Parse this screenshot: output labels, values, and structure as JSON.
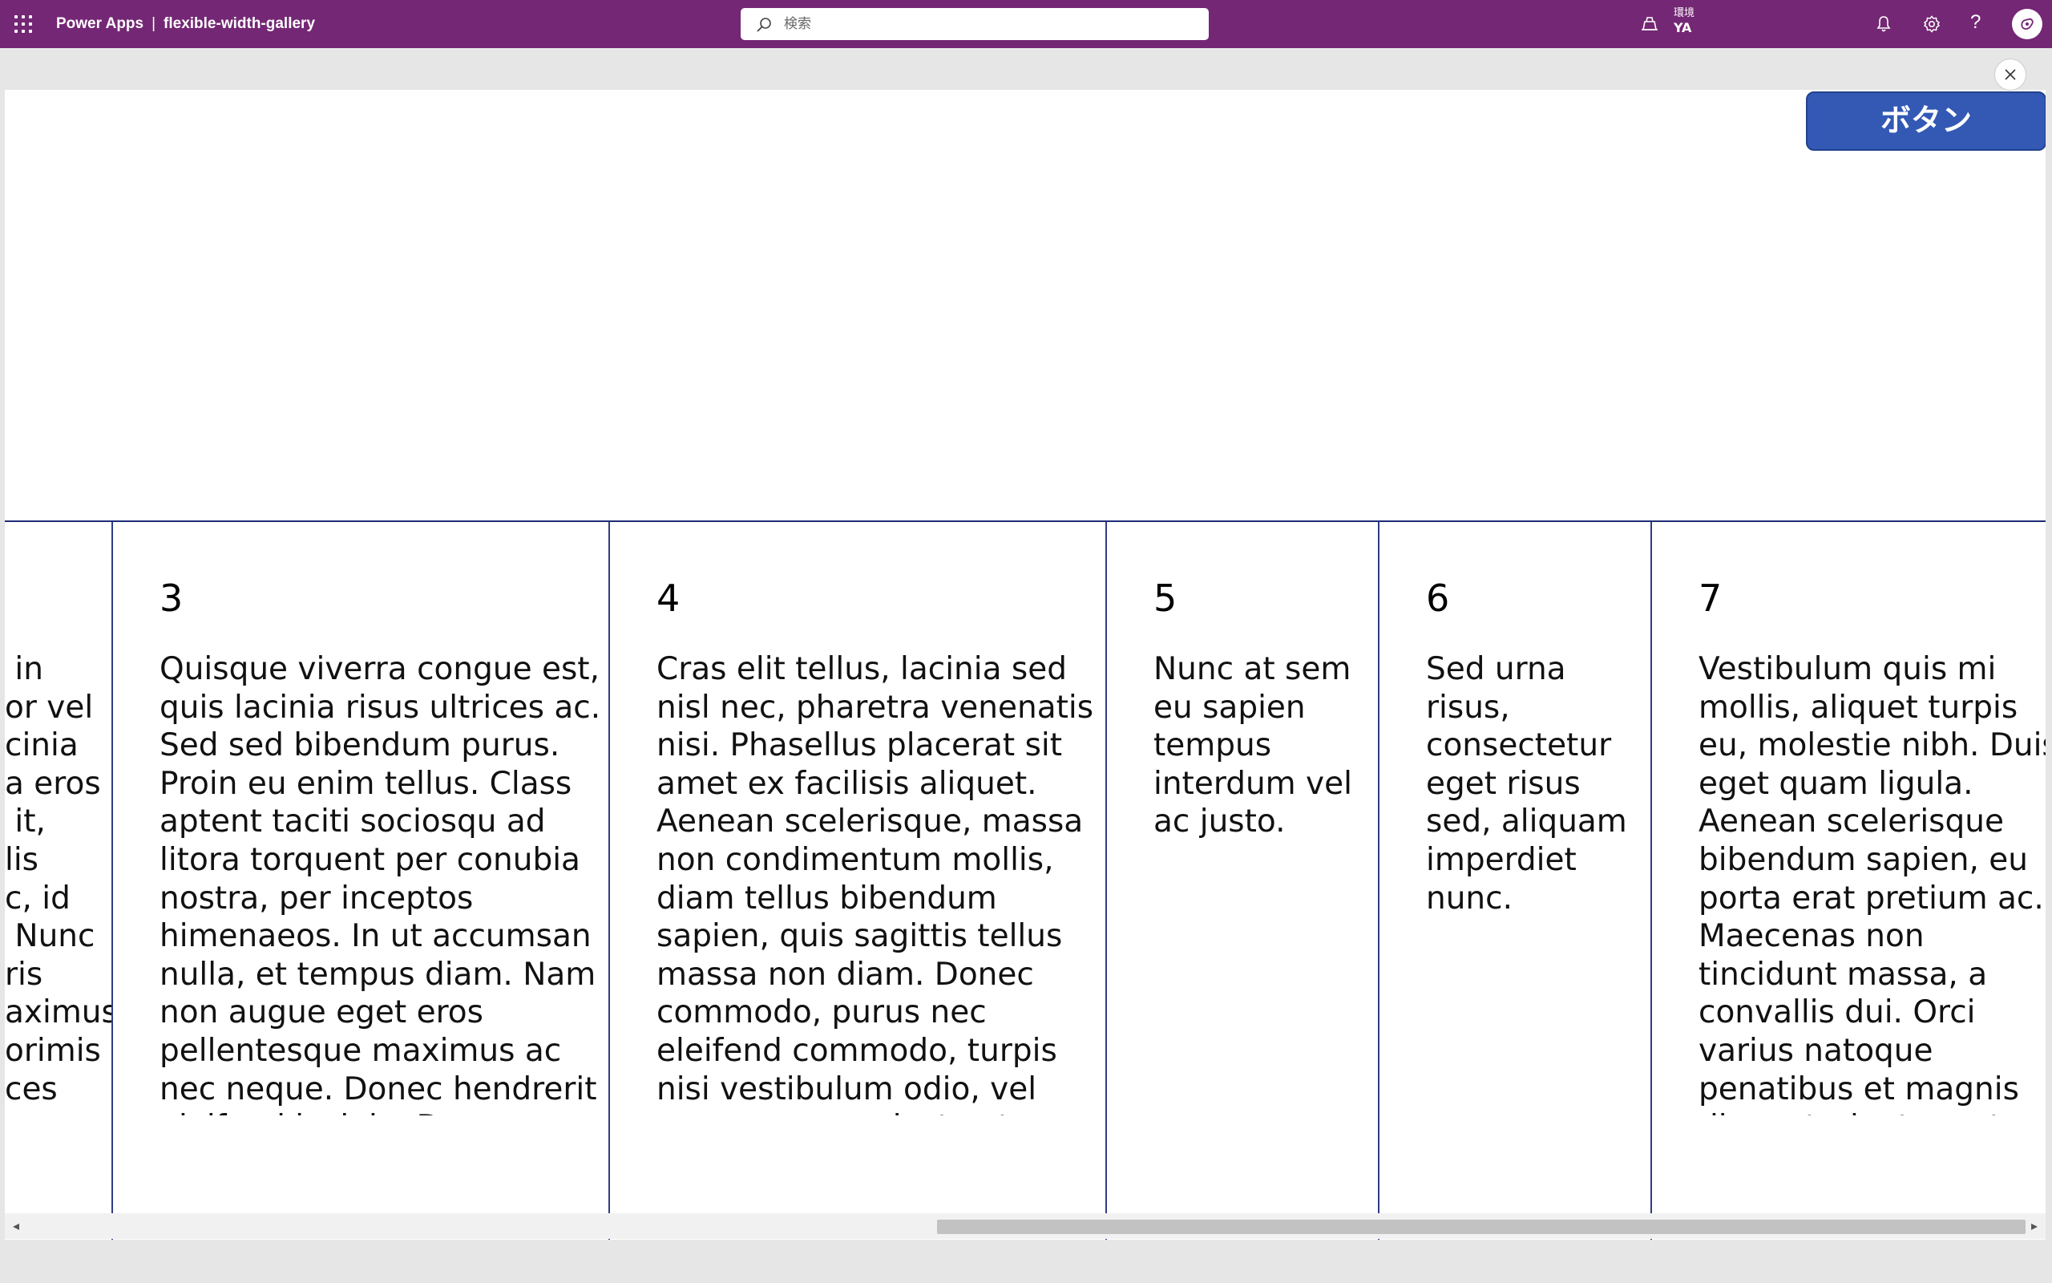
{
  "topbar": {
    "app_name": "Power Apps",
    "separator": "|",
    "app_title": "flexible-width-gallery",
    "search_placeholder": "検索",
    "environment_label": "環境",
    "environment_value": "YA",
    "help_label": "?"
  },
  "canvas": {
    "button_label": "ボタン"
  },
  "gallery": {
    "items": [
      {
        "number": "",
        "text": " in\nor vel\ncinia\na eros\n it,\nlis\nc, id\n Nunc\nris\naximus\norimis\nces"
      },
      {
        "number": "3",
        "text": "Quisque viverra congue est, quis lacinia risus ultrices ac. Sed sed bibendum purus. Proin eu enim tellus. Class aptent taciti sociosqu ad litora torquent per conubia nostra, per inceptos himenaeos. In ut accumsan nulla, et tempus diam. Nam non augue eget eros pellentesque maximus ac nec neque. Donec hendrerit eleifend lacinia. Donec aliquam aliquet nibh"
      },
      {
        "number": "4",
        "text": "Cras elit tellus, lacinia sed nisl nec, pharetra venenatis nisi. Phasellus placerat sit amet ex facilisis aliquet. Aenean scelerisque, massa non condimentum mollis, diam tellus bibendum sapien, quis sagittis tellus massa non diam. Donec commodo, purus nec eleifend commodo, turpis nisi vestibulum odio, vel congue massa justo et neque. Mauris blandit"
      },
      {
        "number": "5",
        "text": "Nunc at sem eu sapien tempus interdum vel ac justo."
      },
      {
        "number": "6",
        "text": "Sed urna risus, consectetur eget risus sed, aliquam imperdiet nunc."
      },
      {
        "number": "7",
        "text": "Vestibulum quis mi mollis, aliquet turpis eu, molestie nibh. Duis eget quam ligula. Aenean scelerisque bibendum sapien, eu porta erat pretium ac. Maecenas non tincidunt massa, a convallis dui. Orci varius natoque penatibus et magnis dis parturient montes, nascetur ridiculus mus. Aliquam"
      }
    ]
  },
  "scrollbar": {
    "left_arrow": "◂",
    "right_arrow": "▸"
  }
}
